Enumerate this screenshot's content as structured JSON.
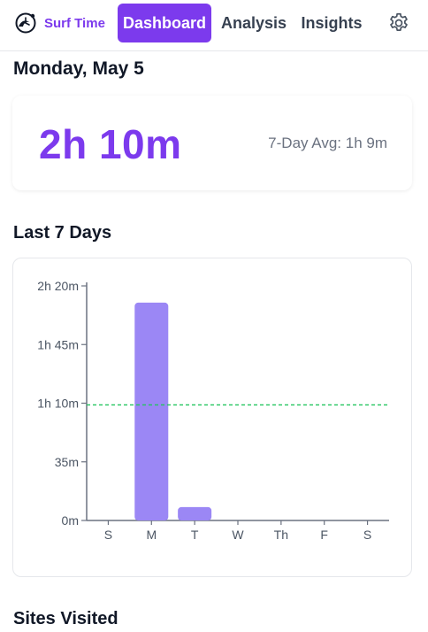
{
  "header": {
    "brand": "Surf Time",
    "tabs": [
      {
        "label": "Dashboard",
        "active": true
      },
      {
        "label": "Analysis",
        "active": false
      },
      {
        "label": "Insights",
        "active": false
      }
    ],
    "settings_icon": "gear-icon",
    "logo_icon": "surf-clock-icon"
  },
  "date_heading": "Monday, May 5",
  "summary": {
    "today_total": "2h 10m",
    "avg_label": "7-Day Avg: 1h 9m"
  },
  "week_section": {
    "title": "Last 7 Days"
  },
  "sites_section": {
    "title": "Sites Visited"
  },
  "colors": {
    "accent": "#7c3aed",
    "bar": "#9b87f5",
    "avg_line": "#22c55e"
  },
  "chart_data": {
    "type": "bar",
    "categories": [
      "S",
      "M",
      "T",
      "W",
      "Th",
      "F",
      "S"
    ],
    "values_minutes": [
      0,
      130,
      8,
      0,
      0,
      0,
      0
    ],
    "ylim_minutes": [
      0,
      140
    ],
    "yticks_minutes": [
      0,
      35,
      70,
      105,
      140
    ],
    "ytick_labels": [
      "0m",
      "35m",
      "1h 10m",
      "1h 45m",
      "2h 20m"
    ],
    "average_minutes": 69,
    "average_line_style": "dashed"
  }
}
